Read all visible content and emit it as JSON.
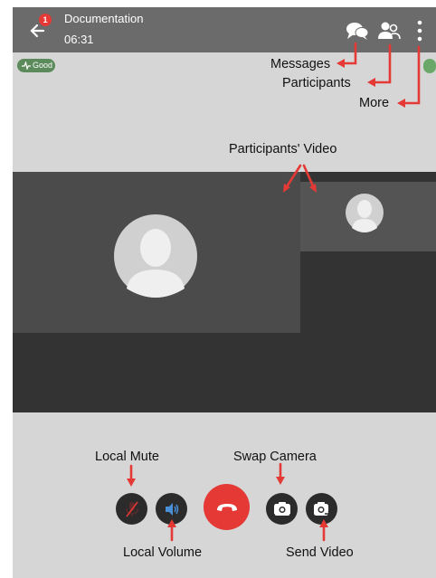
{
  "topbar": {
    "title": "Documentation",
    "timer": "06:31",
    "back_badge": "1"
  },
  "connection": {
    "label": "Good"
  },
  "annotations": {
    "messages": "Messages",
    "participants": "Participants",
    "more": "More",
    "participants_video": "Participants' Video",
    "local_mute": "Local Mute",
    "swap_camera": "Swap Camera",
    "local_volume": "Local Volume",
    "send_video": "Send Video"
  },
  "colors": {
    "topbar": "#6b6b6b",
    "screen": "#d6d6d6",
    "end_call": "#e53935",
    "arrow": "#e53935",
    "volume_icon": "#4a90d9",
    "quality_good": "#5b8a5b"
  },
  "icons": {
    "back": "arrow-left-icon",
    "messages": "chat-bubbles-icon",
    "participants": "people-icon",
    "more": "vertical-dots-icon",
    "mute": "microphone-muted-icon",
    "volume": "speaker-icon",
    "end": "phone-hangup-icon",
    "swap": "camera-swap-icon",
    "send": "camera-send-icon"
  }
}
